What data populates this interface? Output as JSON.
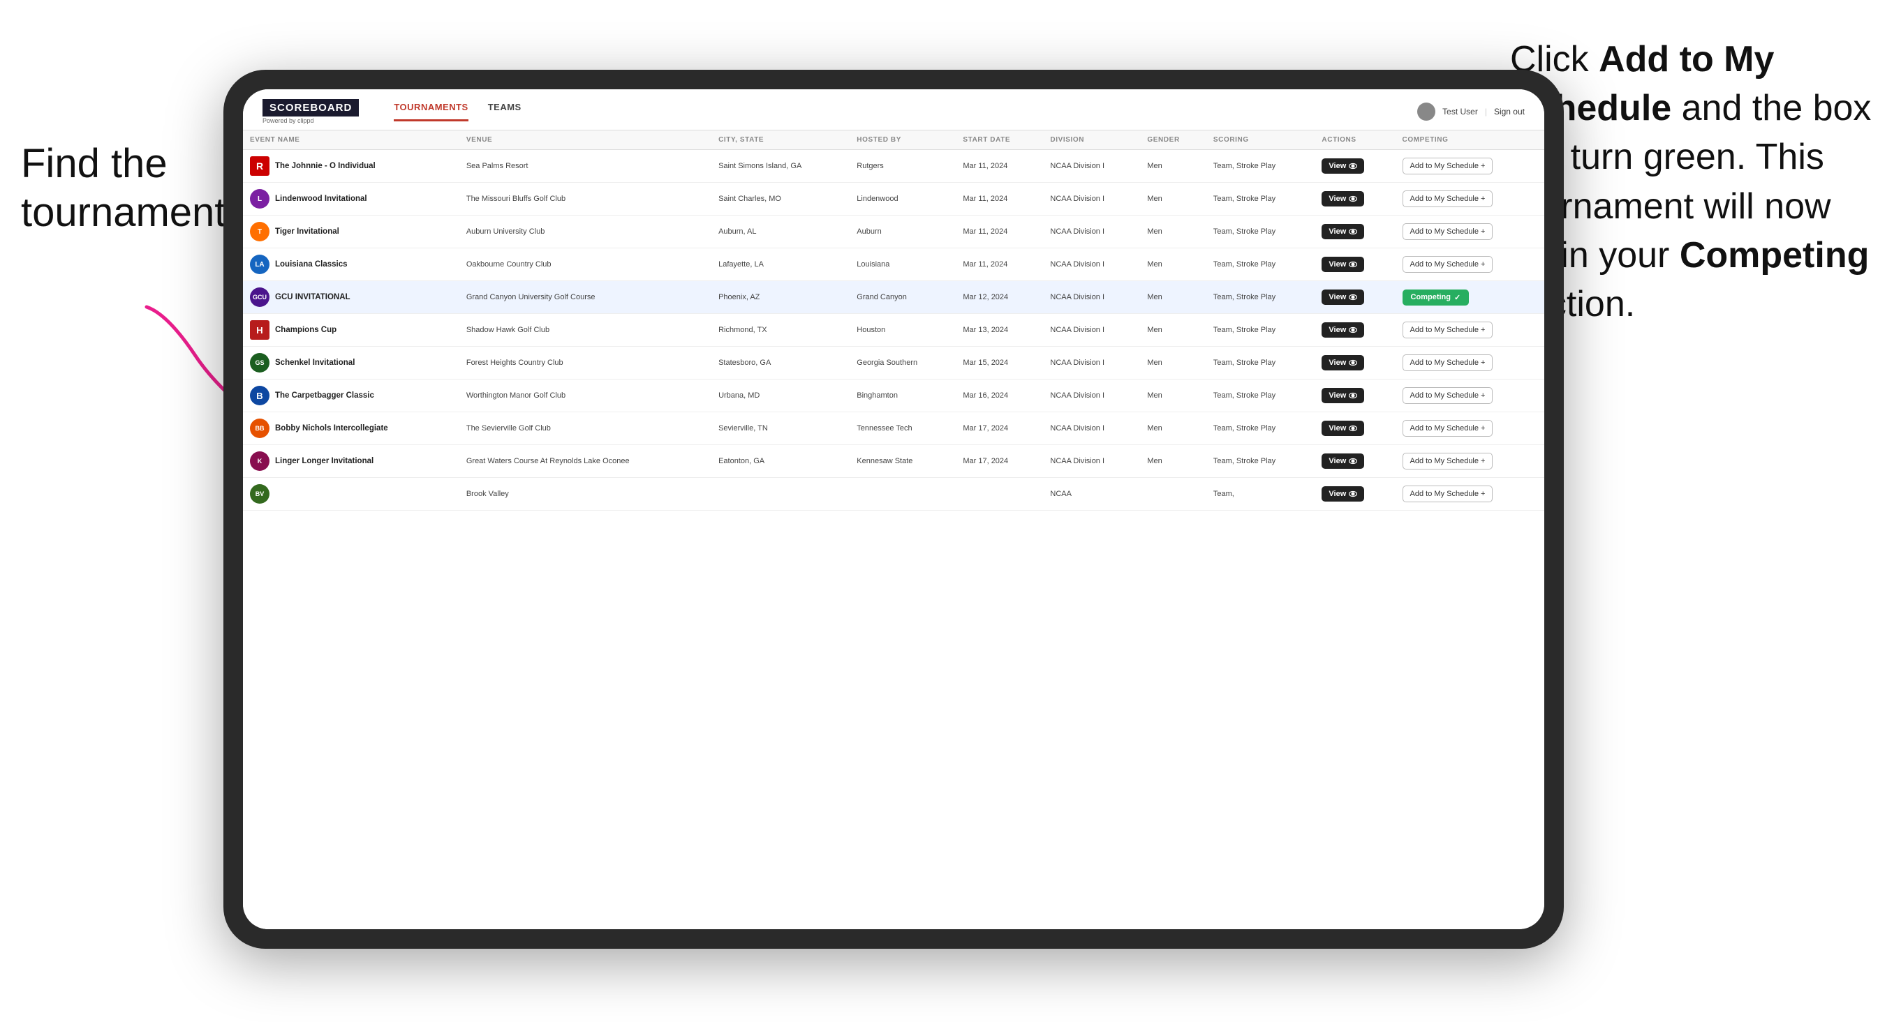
{
  "annotations": {
    "left_title": "Find the tournament.",
    "right_title": "Click ",
    "right_bold1": "Add to My Schedule",
    "right_mid": " and the box will turn green. This tournament will now be in your ",
    "right_bold2": "Competing",
    "right_end": " section."
  },
  "header": {
    "logo": "SCOREBOARD",
    "logo_sub": "Powered by clippd",
    "nav": [
      "TOURNAMENTS",
      "TEAMS"
    ],
    "active_nav": "TOURNAMENTS",
    "user": "Test User",
    "sign_out": "Sign out"
  },
  "table": {
    "columns": [
      "EVENT NAME",
      "VENUE",
      "CITY, STATE",
      "HOSTED BY",
      "START DATE",
      "DIVISION",
      "GENDER",
      "SCORING",
      "ACTIONS",
      "COMPETING"
    ],
    "rows": [
      {
        "logo": "R",
        "logo_class": "logo-r",
        "event": "The Johnnie - O Individual",
        "venue": "Sea Palms Resort",
        "city": "Saint Simons Island, GA",
        "hosted": "Rutgers",
        "date": "Mar 11, 2024",
        "division": "NCAA Division I",
        "gender": "Men",
        "scoring": "Team, Stroke Play",
        "action": "View",
        "competing_label": "Add to My Schedule +",
        "competing_type": "add"
      },
      {
        "logo": "L",
        "logo_class": "logo-l",
        "event": "Lindenwood Invitational",
        "venue": "The Missouri Bluffs Golf Club",
        "city": "Saint Charles, MO",
        "hosted": "Lindenwood",
        "date": "Mar 11, 2024",
        "division": "NCAA Division I",
        "gender": "Men",
        "scoring": "Team, Stroke Play",
        "action": "View",
        "competing_label": "Add to My Schedule +",
        "competing_type": "add"
      },
      {
        "logo": "T",
        "logo_class": "logo-tiger",
        "event": "Tiger Invitational",
        "venue": "Auburn University Club",
        "city": "Auburn, AL",
        "hosted": "Auburn",
        "date": "Mar 11, 2024",
        "division": "NCAA Division I",
        "gender": "Men",
        "scoring": "Team, Stroke Play",
        "action": "View",
        "competing_label": "Add to My Schedule +",
        "competing_type": "add"
      },
      {
        "logo": "LA",
        "logo_class": "logo-la",
        "event": "Louisiana Classics",
        "venue": "Oakbourne Country Club",
        "city": "Lafayette, LA",
        "hosted": "Louisiana",
        "date": "Mar 11, 2024",
        "division": "NCAA Division I",
        "gender": "Men",
        "scoring": "Team, Stroke Play",
        "action": "View",
        "competing_label": "Add to My Schedule +",
        "competing_type": "add"
      },
      {
        "logo": "GCU",
        "logo_class": "logo-gcu",
        "event": "GCU INVITATIONAL",
        "venue": "Grand Canyon University Golf Course",
        "city": "Phoenix, AZ",
        "hosted": "Grand Canyon",
        "date": "Mar 12, 2024",
        "division": "NCAA Division I",
        "gender": "Men",
        "scoring": "Team, Stroke Play",
        "action": "View",
        "competing_label": "Competing ✓",
        "competing_type": "competing",
        "highlighted": true
      },
      {
        "logo": "H",
        "logo_class": "logo-h",
        "event": "Champions Cup",
        "venue": "Shadow Hawk Golf Club",
        "city": "Richmond, TX",
        "hosted": "Houston",
        "date": "Mar 13, 2024",
        "division": "NCAA Division I",
        "gender": "Men",
        "scoring": "Team, Stroke Play",
        "action": "View",
        "competing_label": "Add to My Schedule +",
        "competing_type": "add"
      },
      {
        "logo": "GS",
        "logo_class": "logo-gs",
        "event": "Schenkel Invitational",
        "venue": "Forest Heights Country Club",
        "city": "Statesboro, GA",
        "hosted": "Georgia Southern",
        "date": "Mar 15, 2024",
        "division": "NCAA Division I",
        "gender": "Men",
        "scoring": "Team, Stroke Play",
        "action": "View",
        "competing_label": "Add to My Schedule +",
        "competing_type": "add"
      },
      {
        "logo": "B",
        "logo_class": "logo-b",
        "event": "The Carpetbagger Classic",
        "venue": "Worthington Manor Golf Club",
        "city": "Urbana, MD",
        "hosted": "Binghamton",
        "date": "Mar 16, 2024",
        "division": "NCAA Division I",
        "gender": "Men",
        "scoring": "Team, Stroke Play",
        "action": "View",
        "competing_label": "Add to My Schedule +",
        "competing_type": "add"
      },
      {
        "logo": "BB",
        "logo_class": "logo-bb",
        "event": "Bobby Nichols Intercollegiate",
        "venue": "The Sevierville Golf Club",
        "city": "Sevierville, TN",
        "hosted": "Tennessee Tech",
        "date": "Mar 17, 2024",
        "division": "NCAA Division I",
        "gender": "Men",
        "scoring": "Team, Stroke Play",
        "action": "View",
        "competing_label": "Add to My Schedule +",
        "competing_type": "add"
      },
      {
        "logo": "K",
        "logo_class": "logo-k",
        "event": "Linger Longer Invitational",
        "venue": "Great Waters Course At Reynolds Lake Oconee",
        "city": "Eatonton, GA",
        "hosted": "Kennesaw State",
        "date": "Mar 17, 2024",
        "division": "NCAA Division I",
        "gender": "Men",
        "scoring": "Team, Stroke Play",
        "action": "View",
        "competing_label": "Add to My Schedule +",
        "competing_type": "add"
      },
      {
        "logo": "BV",
        "logo_class": "logo-last",
        "event": "",
        "venue": "Brook Valley",
        "city": "",
        "hosted": "",
        "date": "",
        "division": "NCAA",
        "gender": "",
        "scoring": "Team,",
        "action": "View",
        "competing_label": "Add to My Schedule +",
        "competing_type": "add"
      }
    ]
  }
}
